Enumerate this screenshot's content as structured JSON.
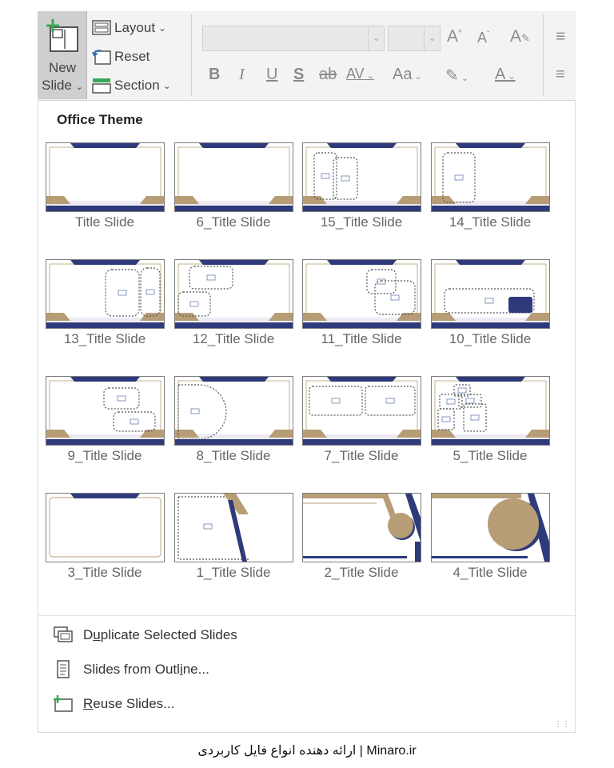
{
  "ribbon": {
    "new_slide_line1": "New",
    "new_slide_line2": "Slide",
    "layout_label": "Layout",
    "reset_label": "Reset",
    "section_label": "Section",
    "format_buttons": [
      "B",
      "I",
      "U",
      "S",
      "ab",
      "AV",
      "Aa"
    ]
  },
  "gallery": {
    "theme_title": "Office Theme",
    "layouts": [
      "Title Slide",
      "6_Title Slide",
      "15_Title Slide",
      "14_Title Slide",
      "13_Title Slide",
      "12_Title Slide",
      "11_Title Slide",
      "10_Title Slide",
      "9_Title Slide",
      "8_Title Slide",
      "7_Title Slide",
      "5_Title Slide",
      "3_Title Slide",
      "1_Title Slide",
      "2_Title Slide",
      "4_Title Slide"
    ]
  },
  "menu": {
    "duplicate_pre": "D",
    "duplicate_ul": "u",
    "duplicate_post": "plicate Selected Slides",
    "outline_pre": "Slides from Outl",
    "outline_ul": "i",
    "outline_post": "ne...",
    "reuse_pre": "",
    "reuse_ul": "R",
    "reuse_post": "euse Slides..."
  },
  "footer": {
    "watermark": "Minaro.ir | ارائه دهنده انواع فایل کاربردی"
  },
  "colors": {
    "navy": "#2e3a7a",
    "tan": "#b79d76",
    "accent_green": "#3aa655"
  }
}
